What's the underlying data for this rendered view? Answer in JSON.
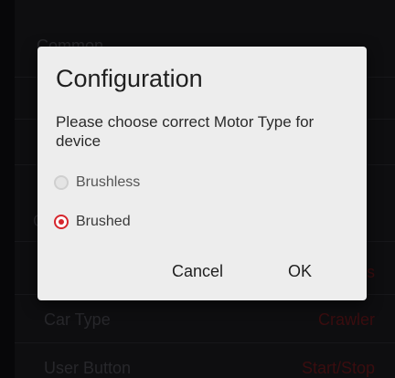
{
  "background": {
    "section_common": "Common",
    "section_other_initial": "C",
    "partial_value": "s",
    "rows": [
      {
        "label": "Car Type",
        "value": "Crawler"
      },
      {
        "label": "User Button",
        "value": "Start/Stop"
      }
    ]
  },
  "dialog": {
    "title": "Configuration",
    "message": "Please choose correct Motor Type for device",
    "options": [
      {
        "label": "Brushless",
        "selected": false
      },
      {
        "label": "Brushed",
        "selected": true
      }
    ],
    "cancel_label": "Cancel",
    "ok_label": "OK"
  },
  "colors": {
    "accent": "#d6262d",
    "dialog_bg": "#ededed",
    "background": "#0c0c0e"
  }
}
